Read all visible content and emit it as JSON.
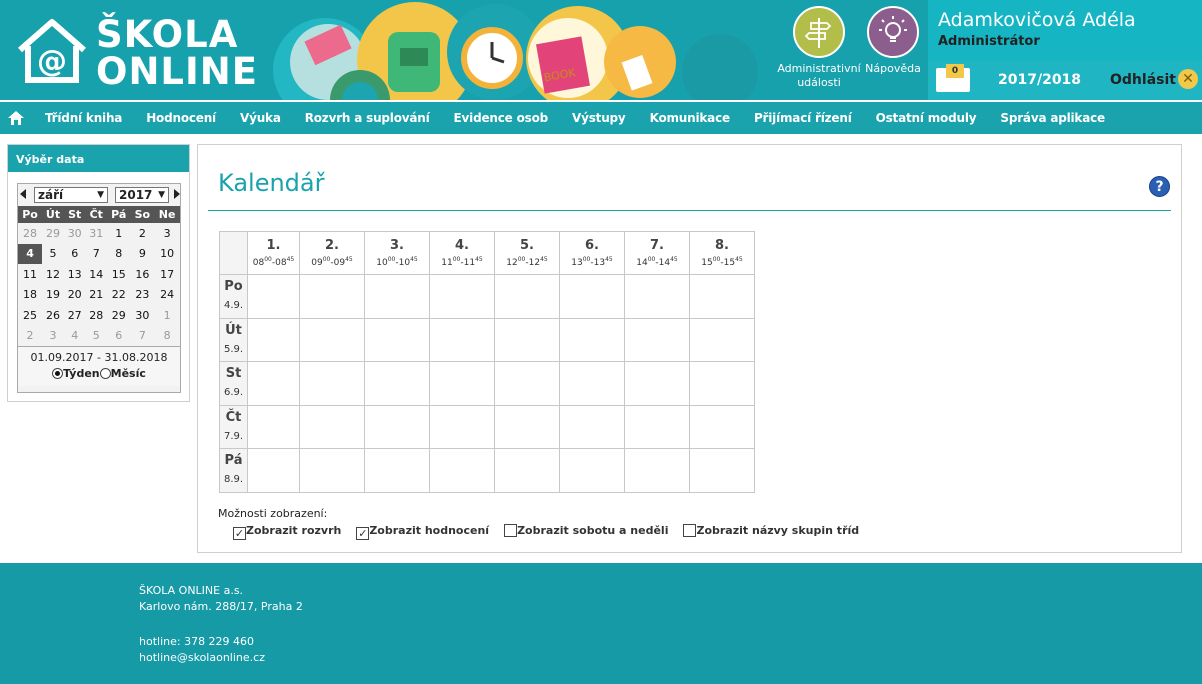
{
  "header": {
    "logo_line1": "ŠKOLA",
    "logo_line2": "ONLINE",
    "admin_events_line1": "Administrativní",
    "admin_events_line2": "události",
    "help_label": "Nápověda",
    "user_name": "Adamkovičová Adéla",
    "user_role": "Administrátor",
    "mail_count": "0",
    "school_year": "2017/2018",
    "logout_label": "Odhlásit"
  },
  "nav": {
    "items": [
      "Třídní kniha",
      "Hodnocení",
      "Výuka",
      "Rozvrh a suplování",
      "Evidence osob",
      "Výstupy",
      "Komunikace",
      "Přijímací řízení",
      "Ostatní moduly",
      "Správa aplikace"
    ]
  },
  "sidebar": {
    "title": "Výběr data",
    "month": "září",
    "year": "2017",
    "weekdays": [
      "Po",
      "Út",
      "St",
      "Čt",
      "Pá",
      "So",
      "Ne"
    ],
    "weeks": [
      [
        "28",
        "29",
        "30",
        "31",
        "1",
        "2",
        "3"
      ],
      [
        "4",
        "5",
        "6",
        "7",
        "8",
        "9",
        "10"
      ],
      [
        "11",
        "12",
        "13",
        "14",
        "15",
        "16",
        "17"
      ],
      [
        "18",
        "19",
        "20",
        "21",
        "22",
        "23",
        "24"
      ],
      [
        "25",
        "26",
        "27",
        "28",
        "29",
        "30",
        "1"
      ],
      [
        "2",
        "3",
        "4",
        "5",
        "6",
        "7",
        "8"
      ]
    ],
    "range": "01.09.2017 - 31.08.2018",
    "radio_week": "Týden",
    "radio_month": "Měsíc"
  },
  "main": {
    "title": "Kalendář",
    "periods": [
      {
        "num": "1.",
        "start": "08",
        "start_m": "00",
        "end": "08",
        "end_m": "45"
      },
      {
        "num": "2.",
        "start": "09",
        "start_m": "00",
        "end": "09",
        "end_m": "45"
      },
      {
        "num": "3.",
        "start": "10",
        "start_m": "00",
        "end": "10",
        "end_m": "45"
      },
      {
        "num": "4.",
        "start": "11",
        "start_m": "00",
        "end": "11",
        "end_m": "45"
      },
      {
        "num": "5.",
        "start": "12",
        "start_m": "00",
        "end": "12",
        "end_m": "45"
      },
      {
        "num": "6.",
        "start": "13",
        "start_m": "00",
        "end": "13",
        "end_m": "45"
      },
      {
        "num": "7.",
        "start": "14",
        "start_m": "00",
        "end": "14",
        "end_m": "45"
      },
      {
        "num": "8.",
        "start": "15",
        "start_m": "00",
        "end": "15",
        "end_m": "45"
      }
    ],
    "days": [
      {
        "name": "Po",
        "date": "4.9."
      },
      {
        "name": "Út",
        "date": "5.9."
      },
      {
        "name": "St",
        "date": "6.9."
      },
      {
        "name": "Čt",
        "date": "7.9."
      },
      {
        "name": "Pá",
        "date": "8.9."
      }
    ],
    "options_label": "Možnosti zobrazení:",
    "options": [
      {
        "label": "Zobrazit rozvrh",
        "checked": true
      },
      {
        "label": "Zobrazit hodnocení",
        "checked": true
      },
      {
        "label": "Zobrazit sobotu a neděli",
        "checked": false
      },
      {
        "label": "Zobrazit názvy skupin tříd",
        "checked": false
      }
    ]
  },
  "footer": {
    "company": "ŠKOLA ONLINE a.s.",
    "address": "Karlovo nám. 288/17, Praha 2",
    "hotline_phone": "hotline: 378 229 460",
    "hotline_email": "hotline@skolaonline.cz"
  },
  "colors": {
    "teal": "#17a1ad",
    "accent": "#1ba3ad",
    "yellow": "#f2c84b"
  }
}
